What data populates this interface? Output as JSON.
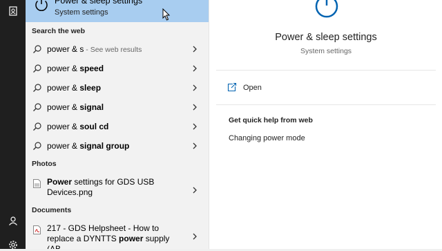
{
  "best_match": {
    "title": "Power & sleep settings",
    "subtitle": "System settings"
  },
  "sections": {
    "web": "Search the web",
    "photos": "Photos",
    "documents": "Documents"
  },
  "web_results": [
    {
      "prefix": "power & s",
      "bold": "",
      "hint": " - See web results"
    },
    {
      "prefix": "power & ",
      "bold": "speed",
      "hint": ""
    },
    {
      "prefix": "power & ",
      "bold": "sleep",
      "hint": ""
    },
    {
      "prefix": "power & ",
      "bold": "signal",
      "hint": ""
    },
    {
      "prefix": "power & ",
      "bold": "soul cd",
      "hint": ""
    },
    {
      "prefix": "power & ",
      "bold": "signal group",
      "hint": ""
    }
  ],
  "photos": [
    {
      "bold": "Power",
      "rest": " settings for GDS USB Devices.png"
    }
  ],
  "documents": [
    {
      "pre": "217 - GDS Helpsheet - How to replace a DYNTTS ",
      "bold": "power",
      "rest": " supply (AB"
    }
  ],
  "preview": {
    "title": "Power & sleep settings",
    "subtitle": "System settings",
    "open_label": "Open",
    "quick_help_title": "Get quick help from web",
    "quick_help_link": "Changing power mode"
  },
  "icons": {
    "rail_top": "notebook-icon",
    "rail_user": "user-icon",
    "rail_settings": "gear-icon",
    "power": "power-icon",
    "search": "search-icon",
    "chevron": "chevron-right-icon",
    "open": "open-in-icon",
    "image_file": "image-file-icon",
    "pdf_file": "pdf-file-icon"
  },
  "colors": {
    "selected_bg": "#a8cdf0",
    "accent": "#0063b1",
    "rail_bg": "#1f1f1f"
  }
}
